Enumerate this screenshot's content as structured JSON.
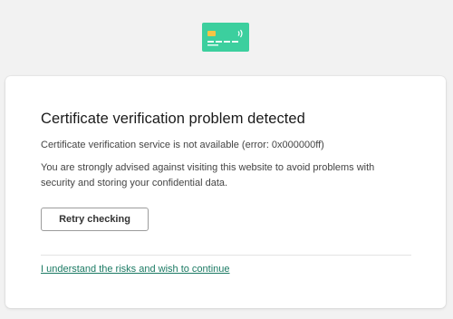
{
  "header": {
    "icon": "credit-card-icon",
    "icon_color": "#3ccf9e"
  },
  "panel": {
    "title": "Certificate verification problem detected",
    "error_line": "Certificate verification service is not available (error: 0x000000ff)",
    "advice": "You are strongly advised against visiting this website to avoid problems with security and storing your confidential data.",
    "retry_label": "Retry checking",
    "continue_link": "I understand the risks and wish to continue"
  },
  "colors": {
    "background": "#f2f2f2",
    "panel": "#ffffff",
    "link": "#1b7a63",
    "accent": "#3ccf9e"
  }
}
